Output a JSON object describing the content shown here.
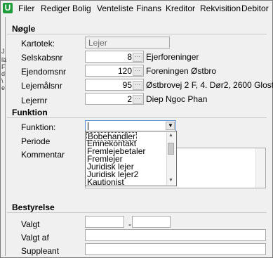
{
  "menubar": {
    "app_icon": "U",
    "items": [
      "Filer",
      "Rediger",
      "Bolig",
      "Venteliste",
      "Finans",
      "Kreditor",
      "Rekvisition",
      "Debitor"
    ]
  },
  "left_strip_chars": [
    "J",
    "lä",
    "F",
    "d",
    "\\",
    "e"
  ],
  "sections": {
    "nogle": {
      "title": "Nøgle",
      "kartotek": {
        "label": "Kartotek:",
        "value": "Lejer"
      },
      "selskabsnr": {
        "label": "Selskabsnr",
        "value": "8",
        "name": "Ejerforeninger"
      },
      "ejendomsnr": {
        "label": "Ejendomsnr",
        "value": "120",
        "name": "Foreningen Østbro"
      },
      "lejemalsnr": {
        "label": "Lejemålsnr",
        "value": "95",
        "name": "Østbrovej 2 F, 4. Dør2, 2600 Glostrup"
      },
      "lejernr": {
        "label": "Lejernr",
        "value": "2",
        "name": "Diep Ngoc Phan"
      }
    },
    "funktion": {
      "title": "Funktion",
      "funktion_label": "Funktion:",
      "funktion_value": "",
      "periode_label": "Periode",
      "kommentar_label": "Kommentar",
      "dropdown_options": [
        "Bobehandler",
        "Emnekontakt",
        "Fremlejebetaler",
        "Fremlejer",
        "Juridisk lejer",
        "Juridisk lejer2",
        "Kautionist"
      ]
    },
    "bestyrelse": {
      "title": "Bestyrelse",
      "valgt_label": "Valgt",
      "valgt_from": "",
      "valgt_to": "",
      "separator": "-",
      "valgt_af_label": "Valgt af",
      "valgt_af_value": "",
      "suppleant_label": "Suppleant",
      "suppleant_value": ""
    }
  },
  "icons": {
    "ellipsis": "ellipsis-icon",
    "dropdown": "chevron-down-icon"
  }
}
